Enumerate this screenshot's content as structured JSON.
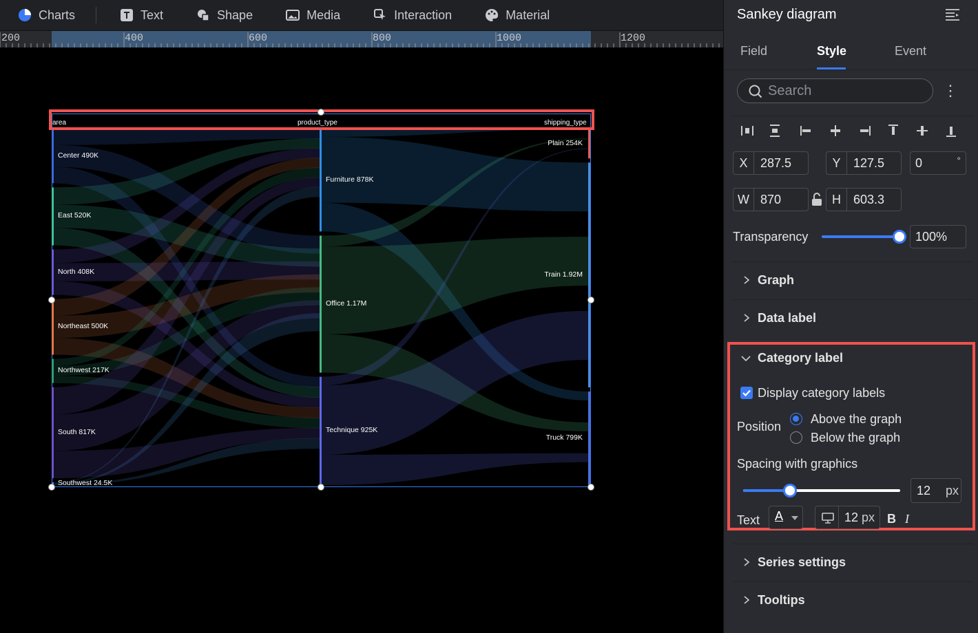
{
  "toolbar": {
    "items": [
      {
        "label": "Charts",
        "icon": "pie-chart-icon"
      },
      {
        "label": "Text",
        "icon": "text-icon"
      },
      {
        "label": "Shape",
        "icon": "shape-icon"
      },
      {
        "label": "Media",
        "icon": "image-icon"
      },
      {
        "label": "Interaction",
        "icon": "interaction-icon"
      },
      {
        "label": "Material",
        "icon": "palette-icon"
      }
    ]
  },
  "ruler": {
    "labels": [
      "200",
      "400",
      "600",
      "800",
      "1000",
      "1200"
    ]
  },
  "chart": {
    "category_labels": [
      "area",
      "product_type",
      "shipping_type"
    ],
    "area_nodes": [
      {
        "name": "Center",
        "value": "490K",
        "color": "#3d6bd9"
      },
      {
        "name": "East",
        "value": "520K",
        "color": "#3fc1a0"
      },
      {
        "name": "North",
        "value": "408K",
        "color": "#6a5bd6"
      },
      {
        "name": "Northeast",
        "value": "500K",
        "color": "#e07a4a"
      },
      {
        "name": "Northwest",
        "value": "217K",
        "color": "#2f9d7a"
      },
      {
        "name": "South",
        "value": "817K",
        "color": "#6c53c8"
      },
      {
        "name": "Southwest",
        "value": "24.5K",
        "color": "#4a8fe0"
      }
    ],
    "product_nodes": [
      {
        "name": "Furniture",
        "value": "878K",
        "color": "#2f8fe6"
      },
      {
        "name": "Office",
        "value": "1.17M",
        "color": "#49b884"
      },
      {
        "name": "Technique",
        "value": "925K",
        "color": "#5e68e8"
      }
    ],
    "shipping_nodes": [
      {
        "name": "Plain",
        "value": "254K",
        "color": "#e0605a"
      },
      {
        "name": "Train",
        "value": "1.92M",
        "color": "#4a8fe0"
      },
      {
        "name": "Truck",
        "value": "799K",
        "color": "#4a6fe0"
      }
    ]
  },
  "panel": {
    "title": "Sankey diagram",
    "tabs": [
      "Field",
      "Style",
      "Event"
    ],
    "active_tab": "Style",
    "search_placeholder": "Search",
    "geometry_fields": {
      "x_label": "X",
      "x_value": "287.5",
      "y_label": "Y",
      "y_value": "127.5",
      "rotation_value": "0",
      "rotation_unit": "°",
      "w_label": "W",
      "w_value": "870",
      "h_label": "H",
      "h_value": "603.3"
    },
    "transparency": {
      "label": "Transparency",
      "value": "100%",
      "level": 1.0
    },
    "sections": {
      "graph": "Graph",
      "data_label": "Data label",
      "category_label": "Category label",
      "series_settings": "Series settings",
      "tooltips": "Tooltips"
    },
    "category_label": {
      "display_label": "Display category labels",
      "display_checked": true,
      "position_label": "Position",
      "position_options": [
        "Above the graph",
        "Below the graph"
      ],
      "position_selected": "Above the graph",
      "spacing_label": "Spacing with graphics",
      "spacing_value": "12",
      "spacing_unit": "px",
      "spacing_level": 0.3,
      "text_label": "Text",
      "font_size": "12",
      "font_unit": "px",
      "bold_label": "B",
      "italic_label": "I",
      "text_color_glyph": "A"
    },
    "accent_color": "#3a7bf5",
    "highlight_color": "#f0524d"
  }
}
